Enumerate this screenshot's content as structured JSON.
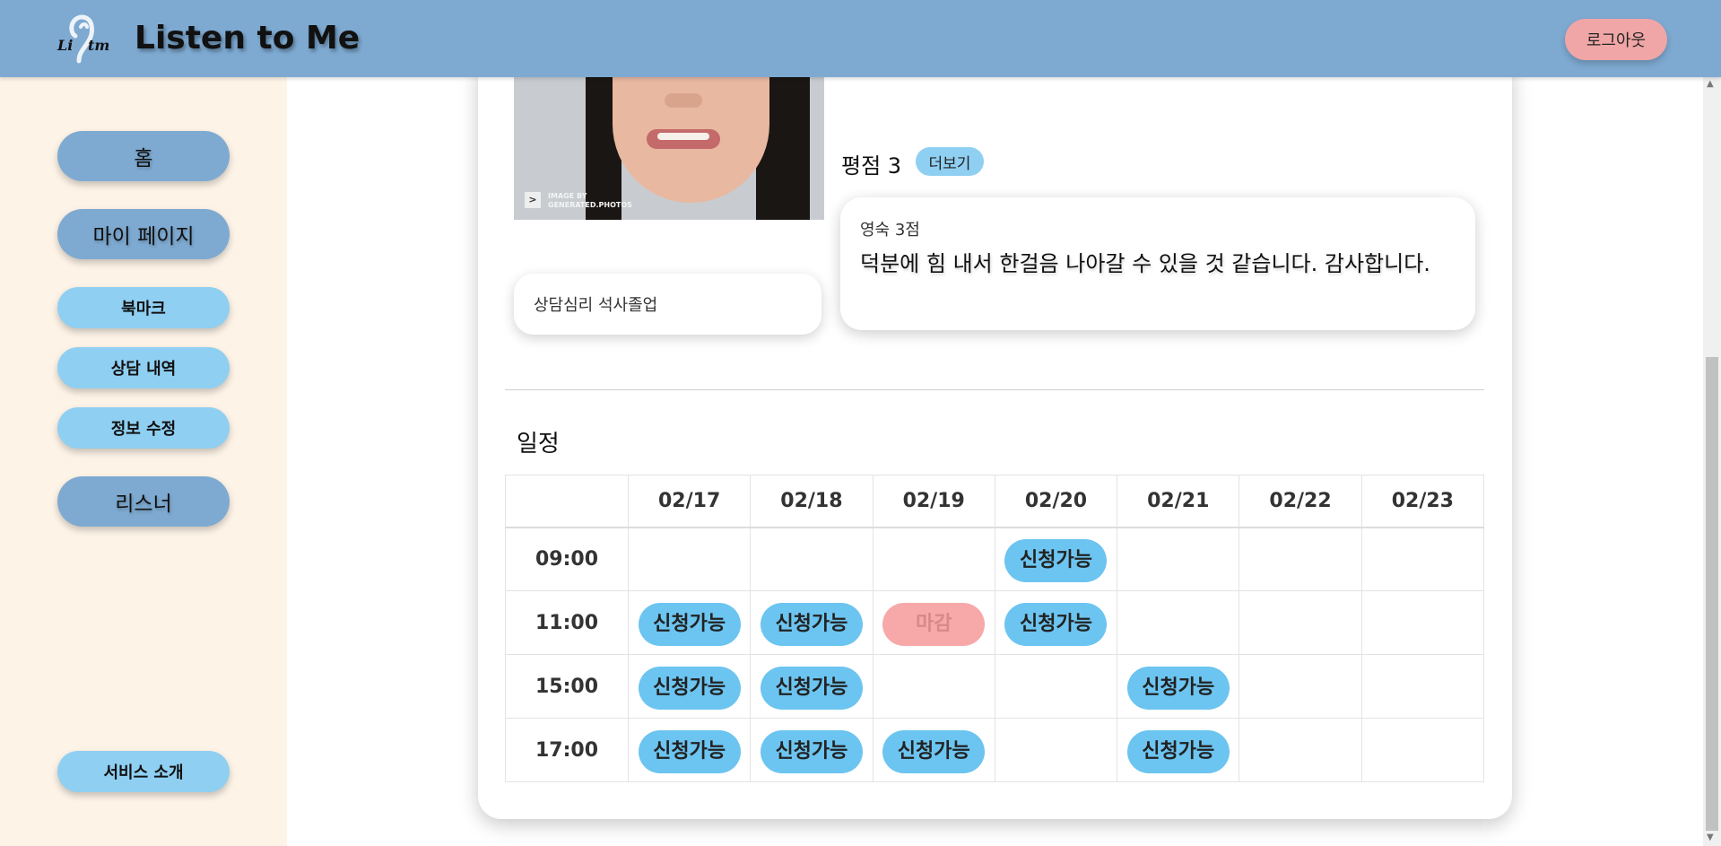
{
  "header": {
    "logo_text": "Li Stn",
    "title": "Listen to Me",
    "logout_label": "로그아웃"
  },
  "sidebar": {
    "items": [
      {
        "label": "홈"
      },
      {
        "label": "마이 페이지"
      },
      {
        "label": "북마크"
      },
      {
        "label": "상담 내역"
      },
      {
        "label": "정보 수정"
      },
      {
        "label": "리스너"
      },
      {
        "label": "서비스 소개"
      }
    ]
  },
  "profile": {
    "photo_caption_line1": "IMAGE BY",
    "photo_caption_line2": "GENERATED.PHOTOS",
    "education": "상담심리 석사졸업",
    "rating_label": "평점 3",
    "more_label": "더보기"
  },
  "review": {
    "author": "영숙 3점",
    "text": "덕분에 힘 내서 한걸음 나아갈 수 있을 것 같습니다. 감사합니다."
  },
  "schedule": {
    "title": "일정",
    "dates": [
      "02/17",
      "02/18",
      "02/19",
      "02/20",
      "02/21",
      "02/22",
      "02/23"
    ],
    "rows": [
      {
        "time": "09:00",
        "slots": [
          "",
          "",
          "",
          "신청가능",
          "",
          "",
          ""
        ]
      },
      {
        "time": "11:00",
        "slots": [
          "신청가능",
          "신청가능",
          "마감",
          "신청가능",
          "",
          "",
          ""
        ]
      },
      {
        "time": "15:00",
        "slots": [
          "신청가능",
          "신청가능",
          "",
          "",
          "신청가능",
          "",
          ""
        ]
      },
      {
        "time": "17:00",
        "slots": [
          "신청가능",
          "신청가능",
          "신청가능",
          "",
          "신청가능",
          "",
          ""
        ]
      }
    ]
  },
  "colors": {
    "header": "#7eaad2",
    "sidebar_bg": "#fdf3e7",
    "available": "#6cc4f0",
    "closed": "#f7a9a9",
    "logout": "#f0a6a6"
  }
}
